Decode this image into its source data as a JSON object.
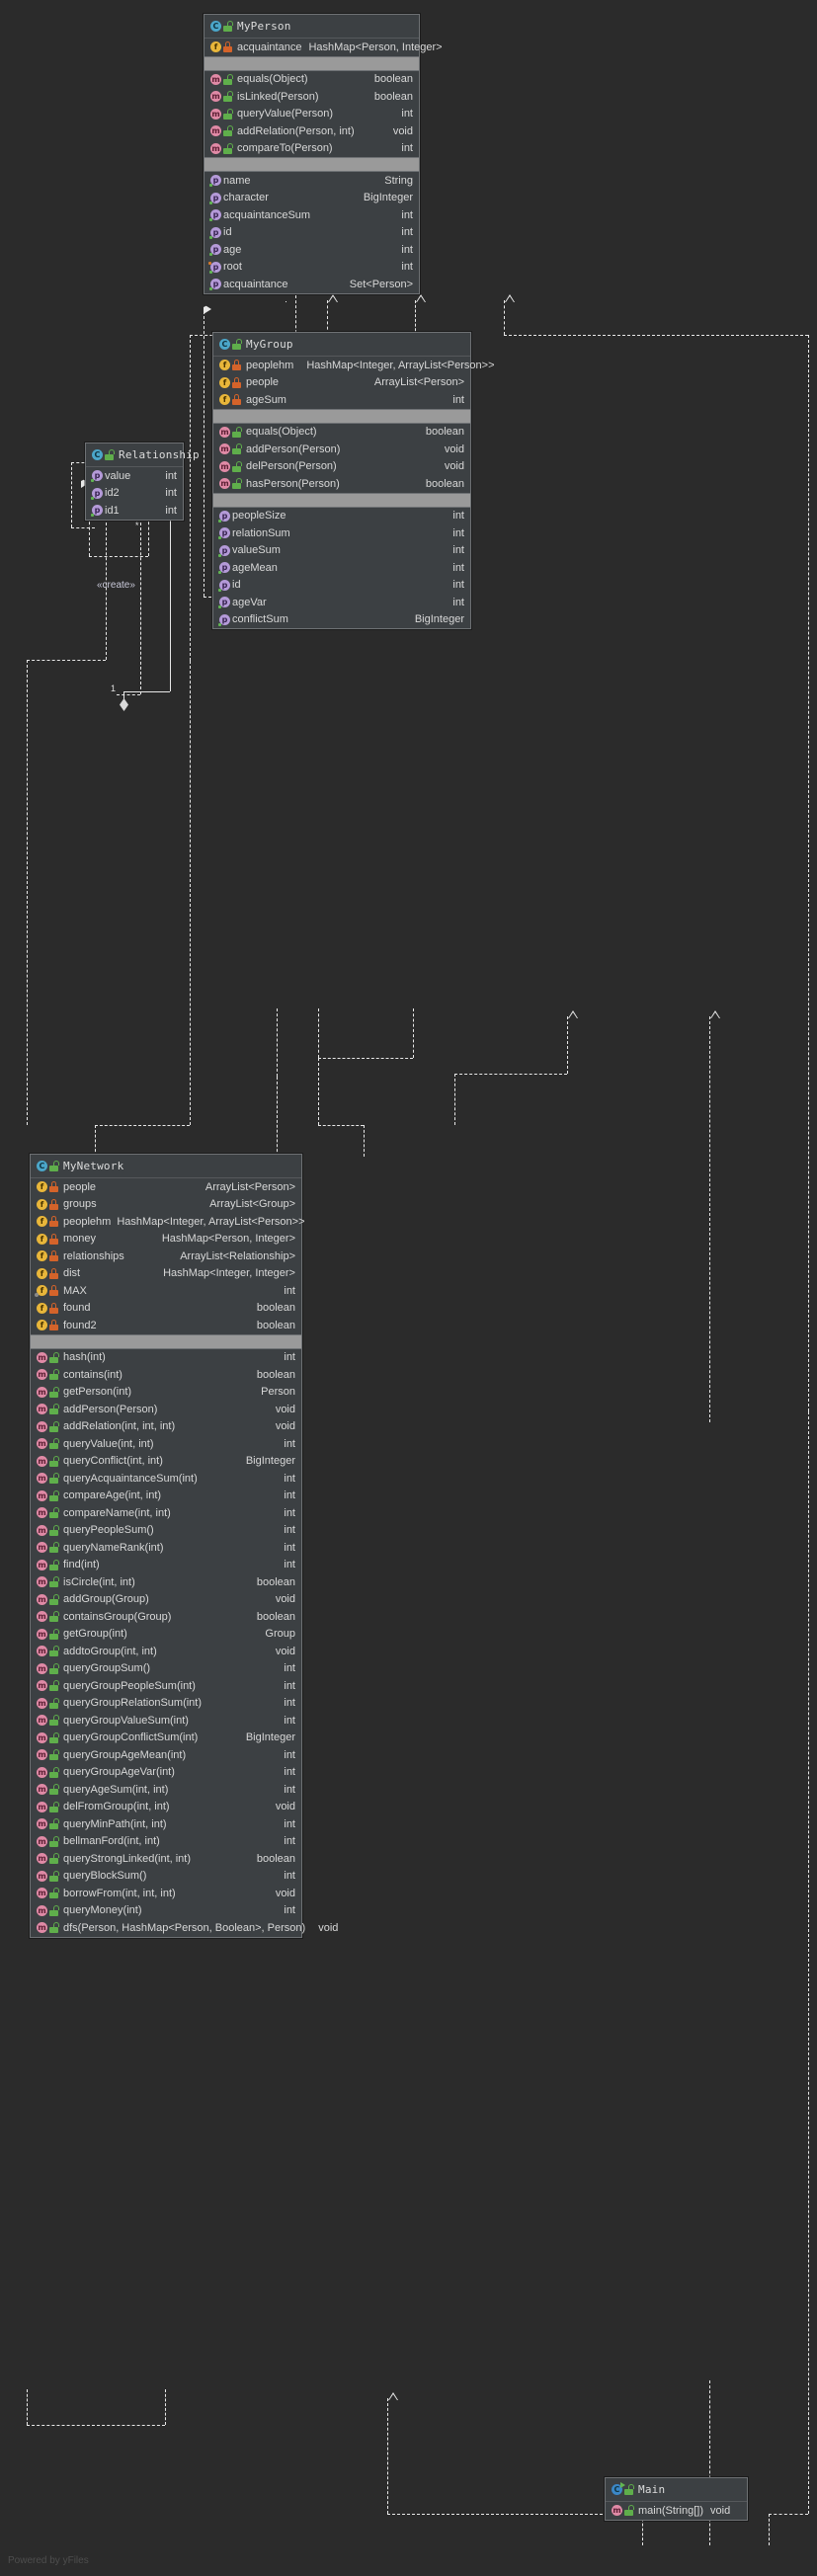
{
  "diagram": {
    "title": "UML Class Diagram",
    "watermark": "Powered by yFiles",
    "background": "#2b2b2b",
    "box_fill": "#3c4043",
    "separator_fill": "#9a9a9a",
    "line_color": "#e8e8e8"
  },
  "edge_labels": {
    "create": "«create»",
    "mult_one": "1",
    "mult_many": "*"
  },
  "classes": {
    "my_person": {
      "name": "MyPerson",
      "icon": "class-icon",
      "fields": [
        {
          "icon": "field-icon",
          "visibility": "private",
          "name": "acquaintance",
          "type": "HashMap<Person, Integer>"
        }
      ],
      "methods": [
        {
          "icon": "method-icon",
          "visibility": "public",
          "name": "equals(Object)",
          "type": "boolean"
        },
        {
          "icon": "method-icon",
          "visibility": "public",
          "name": "isLinked(Person)",
          "type": "boolean"
        },
        {
          "icon": "method-icon",
          "visibility": "public",
          "name": "queryValue(Person)",
          "type": "int"
        },
        {
          "icon": "method-icon",
          "visibility": "public",
          "name": "addRelation(Person, int)",
          "type": "void"
        },
        {
          "icon": "method-icon",
          "visibility": "public",
          "name": "compareTo(Person)",
          "type": "int"
        }
      ],
      "properties": [
        {
          "icon": "property-icon",
          "name": "name",
          "type": "String"
        },
        {
          "icon": "property-icon",
          "name": "character",
          "type": "BigInteger"
        },
        {
          "icon": "property-icon",
          "name": "acquaintanceSum",
          "type": "int"
        },
        {
          "icon": "property-icon",
          "name": "id",
          "type": "int"
        },
        {
          "icon": "property-icon",
          "name": "age",
          "type": "int"
        },
        {
          "icon": "property-icon",
          "name": "root",
          "type": "int"
        },
        {
          "icon": "property-icon",
          "name": "acquaintance",
          "type": "Set<Person>"
        }
      ]
    },
    "my_group": {
      "name": "MyGroup",
      "icon": "class-icon",
      "fields": [
        {
          "icon": "field-icon",
          "visibility": "private",
          "name": "peoplehm",
          "type": "HashMap<Integer, ArrayList<Person>>"
        },
        {
          "icon": "field-icon",
          "visibility": "private",
          "name": "people",
          "type": "ArrayList<Person>"
        },
        {
          "icon": "field-icon",
          "visibility": "private",
          "name": "ageSum",
          "type": "int"
        }
      ],
      "methods": [
        {
          "icon": "method-icon",
          "visibility": "public",
          "name": "equals(Object)",
          "type": "boolean"
        },
        {
          "icon": "method-icon",
          "visibility": "public",
          "name": "addPerson(Person)",
          "type": "void"
        },
        {
          "icon": "method-icon",
          "visibility": "public",
          "name": "delPerson(Person)",
          "type": "void"
        },
        {
          "icon": "method-icon",
          "visibility": "public",
          "name": "hasPerson(Person)",
          "type": "boolean"
        }
      ],
      "properties": [
        {
          "icon": "property-icon",
          "name": "peopleSize",
          "type": "int"
        },
        {
          "icon": "property-icon",
          "name": "relationSum",
          "type": "int"
        },
        {
          "icon": "property-icon",
          "name": "valueSum",
          "type": "int"
        },
        {
          "icon": "property-icon",
          "name": "ageMean",
          "type": "int"
        },
        {
          "icon": "property-icon",
          "name": "id",
          "type": "int"
        },
        {
          "icon": "property-icon",
          "name": "ageVar",
          "type": "int"
        },
        {
          "icon": "property-icon",
          "name": "conflictSum",
          "type": "BigInteger"
        }
      ]
    },
    "relationship": {
      "name": "Relationship",
      "icon": "class-icon",
      "properties": [
        {
          "icon": "property-icon",
          "name": "value",
          "type": "int"
        },
        {
          "icon": "property-icon",
          "name": "id2",
          "type": "int"
        },
        {
          "icon": "property-icon",
          "name": "id1",
          "type": "int"
        }
      ]
    },
    "my_network": {
      "name": "MyNetwork",
      "icon": "class-icon",
      "fields": [
        {
          "icon": "field-icon",
          "visibility": "private",
          "name": "people",
          "type": "ArrayList<Person>"
        },
        {
          "icon": "field-icon",
          "visibility": "private",
          "name": "groups",
          "type": "ArrayList<Group>"
        },
        {
          "icon": "field-icon",
          "visibility": "private",
          "name": "peoplehm",
          "type": "HashMap<Integer, ArrayList<Person>>"
        },
        {
          "icon": "field-icon",
          "visibility": "private",
          "name": "money",
          "type": "HashMap<Person, Integer>"
        },
        {
          "icon": "field-icon",
          "visibility": "private",
          "name": "relationships",
          "type": "ArrayList<Relationship>"
        },
        {
          "icon": "field-icon",
          "visibility": "private",
          "name": "dist",
          "type": "HashMap<Integer, Integer>"
        },
        {
          "icon": "field-icon",
          "visibility": "private",
          "name": "MAX",
          "type": "int",
          "static": true
        },
        {
          "icon": "field-icon",
          "visibility": "private",
          "name": "found",
          "type": "boolean"
        },
        {
          "icon": "field-icon",
          "visibility": "private",
          "name": "found2",
          "type": "boolean"
        }
      ],
      "methods": [
        {
          "icon": "method-icon",
          "visibility": "public",
          "name": "hash(int)",
          "type": "int"
        },
        {
          "icon": "method-icon",
          "visibility": "public",
          "name": "contains(int)",
          "type": "boolean"
        },
        {
          "icon": "method-icon",
          "visibility": "public",
          "name": "getPerson(int)",
          "type": "Person"
        },
        {
          "icon": "method-icon",
          "visibility": "public",
          "name": "addPerson(Person)",
          "type": "void"
        },
        {
          "icon": "method-icon",
          "visibility": "public",
          "name": "addRelation(int, int, int)",
          "type": "void"
        },
        {
          "icon": "method-icon",
          "visibility": "public",
          "name": "queryValue(int, int)",
          "type": "int"
        },
        {
          "icon": "method-icon",
          "visibility": "public",
          "name": "queryConflict(int, int)",
          "type": "BigInteger"
        },
        {
          "icon": "method-icon",
          "visibility": "public",
          "name": "queryAcquaintanceSum(int)",
          "type": "int"
        },
        {
          "icon": "method-icon",
          "visibility": "public",
          "name": "compareAge(int, int)",
          "type": "int"
        },
        {
          "icon": "method-icon",
          "visibility": "public",
          "name": "compareName(int, int)",
          "type": "int"
        },
        {
          "icon": "method-icon",
          "visibility": "public",
          "name": "queryPeopleSum()",
          "type": "int"
        },
        {
          "icon": "method-icon",
          "visibility": "public",
          "name": "queryNameRank(int)",
          "type": "int"
        },
        {
          "icon": "method-icon",
          "visibility": "public",
          "name": "find(int)",
          "type": "int"
        },
        {
          "icon": "method-icon",
          "visibility": "public",
          "name": "isCircle(int, int)",
          "type": "boolean"
        },
        {
          "icon": "method-icon",
          "visibility": "public",
          "name": "addGroup(Group)",
          "type": "void"
        },
        {
          "icon": "method-icon",
          "visibility": "public",
          "name": "containsGroup(Group)",
          "type": "boolean"
        },
        {
          "icon": "method-icon",
          "visibility": "public",
          "name": "getGroup(int)",
          "type": "Group"
        },
        {
          "icon": "method-icon",
          "visibility": "public",
          "name": "addtoGroup(int, int)",
          "type": "void"
        },
        {
          "icon": "method-icon",
          "visibility": "public",
          "name": "queryGroupSum()",
          "type": "int"
        },
        {
          "icon": "method-icon",
          "visibility": "public",
          "name": "queryGroupPeopleSum(int)",
          "type": "int"
        },
        {
          "icon": "method-icon",
          "visibility": "public",
          "name": "queryGroupRelationSum(int)",
          "type": "int"
        },
        {
          "icon": "method-icon",
          "visibility": "public",
          "name": "queryGroupValueSum(int)",
          "type": "int"
        },
        {
          "icon": "method-icon",
          "visibility": "public",
          "name": "queryGroupConflictSum(int)",
          "type": "BigInteger"
        },
        {
          "icon": "method-icon",
          "visibility": "public",
          "name": "queryGroupAgeMean(int)",
          "type": "int"
        },
        {
          "icon": "method-icon",
          "visibility": "public",
          "name": "queryGroupAgeVar(int)",
          "type": "int"
        },
        {
          "icon": "method-icon",
          "visibility": "public",
          "name": "queryAgeSum(int, int)",
          "type": "int"
        },
        {
          "icon": "method-icon",
          "visibility": "public",
          "name": "delFromGroup(int, int)",
          "type": "void"
        },
        {
          "icon": "method-icon",
          "visibility": "public",
          "name": "queryMinPath(int, int)",
          "type": "int"
        },
        {
          "icon": "method-icon",
          "visibility": "public",
          "name": "bellmanFord(int, int)",
          "type": "int"
        },
        {
          "icon": "method-icon",
          "visibility": "public",
          "name": "queryStrongLinked(int, int)",
          "type": "boolean"
        },
        {
          "icon": "method-icon",
          "visibility": "public",
          "name": "queryBlockSum()",
          "type": "int"
        },
        {
          "icon": "method-icon",
          "visibility": "public",
          "name": "borrowFrom(int, int, int)",
          "type": "void"
        },
        {
          "icon": "method-icon",
          "visibility": "public",
          "name": "queryMoney(int)",
          "type": "int"
        },
        {
          "icon": "method-icon",
          "visibility": "public",
          "name": "dfs(Person, HashMap<Person, Boolean>, Person)",
          "type": "void"
        }
      ]
    },
    "main": {
      "name": "Main",
      "icon": "class-runnable-icon",
      "methods": [
        {
          "icon": "method-icon",
          "visibility": "public",
          "name": "main(String[])",
          "type": "void"
        }
      ]
    }
  }
}
